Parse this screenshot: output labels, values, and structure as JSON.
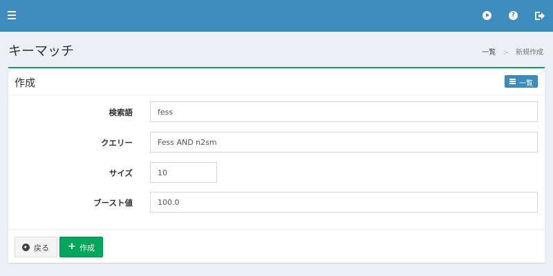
{
  "header": {
    "icons": [
      "menu-icon",
      "play-circle-icon",
      "help-icon",
      "logout-icon"
    ],
    "brand_color": "#3c8dbc"
  },
  "page": {
    "title": "キーマッチ"
  },
  "breadcrumb": {
    "items": [
      "一覧",
      "新規作成"
    ],
    "separator": ">"
  },
  "box": {
    "title": "作成",
    "list_button_label": "一覧",
    "accent_color": "#00a65a"
  },
  "form": {
    "fields": [
      {
        "label": "検索語",
        "value": "fess"
      },
      {
        "label": "クエリー",
        "value": "Fess AND n2sm"
      },
      {
        "label": "サイズ",
        "value": "10"
      },
      {
        "label": "ブースト値",
        "value": "100.0"
      }
    ]
  },
  "footer": {
    "back_label": "戻る",
    "create_label": "作成",
    "create_color": "#00a65a"
  }
}
